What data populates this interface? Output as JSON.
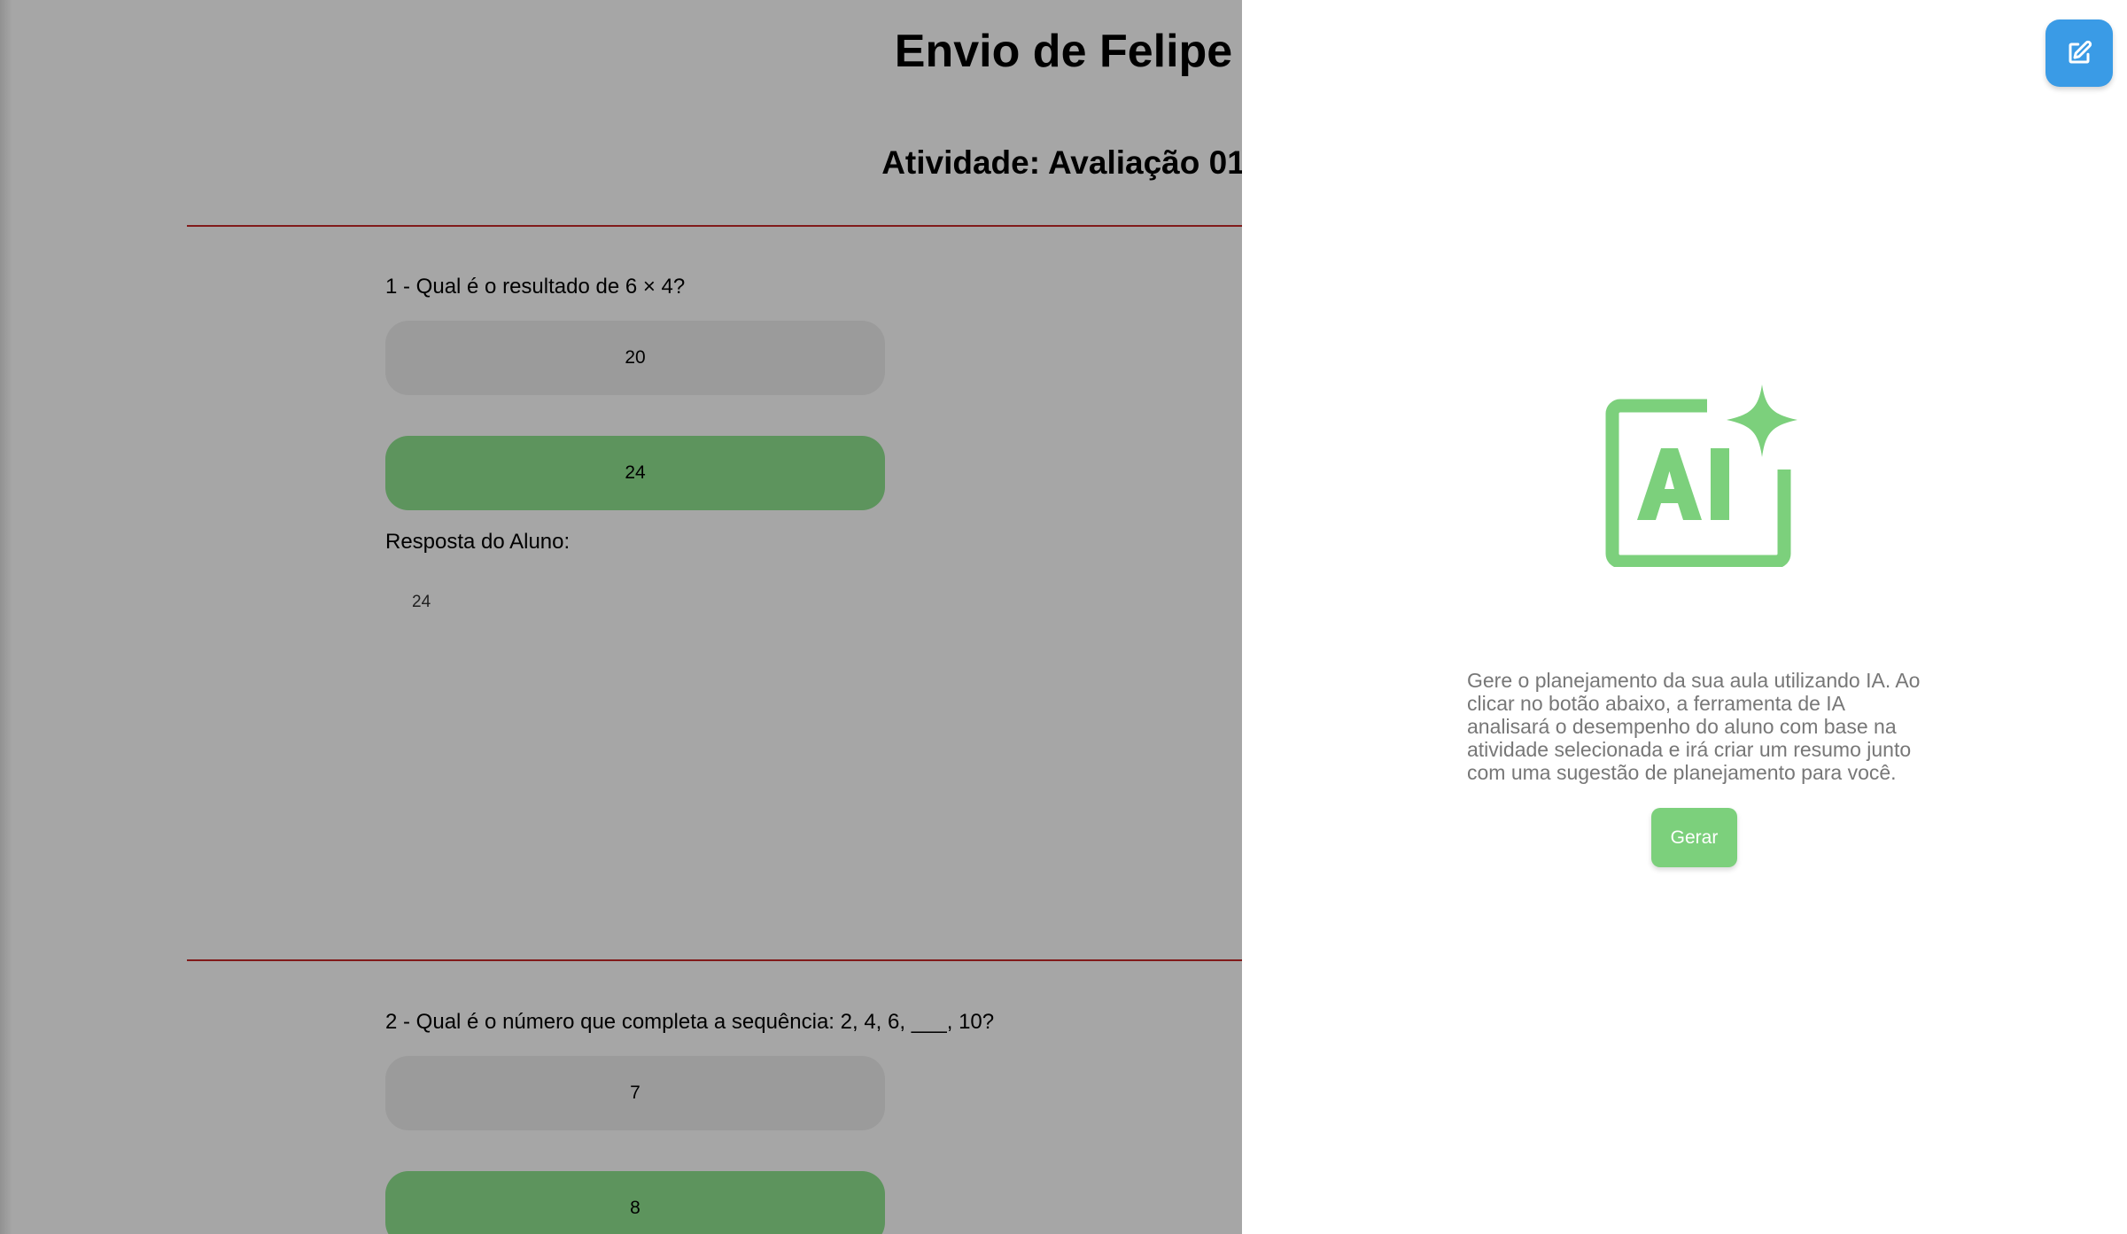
{
  "page": {
    "title": "Envio de Felipe",
    "activity_title": "Atividade: Avaliação 01",
    "answer_label": "Resposta do Aluno:",
    "questions": [
      {
        "text": "1 - Qual é o resultado de 6 × 4?",
        "options": [
          {
            "label": "20",
            "correct": false
          },
          {
            "label": "24",
            "correct": true
          }
        ],
        "student_answer": "24"
      },
      {
        "text": "2 - Qual é o número que completa a sequência: 2, 4, 6, ___, 10?",
        "options": [
          {
            "label": "7",
            "correct": false
          },
          {
            "label": "8",
            "correct": true
          }
        ]
      }
    ]
  },
  "drawer": {
    "description": "Gere o planejamento da sua aula utilizando IA. Ao clicar no botão abaixo, a ferramenta de IA analisará o desempenho do aluno com base na atividade selecionada e irá criar um resumo junto com uma sugestão de planejamento para você.",
    "generate_label": "Gerar",
    "icons": {
      "edit": "edit-icon",
      "ai": "ai-sparkle-icon"
    }
  },
  "colors": {
    "correct_option": "#8fe38f",
    "option": "#efefef",
    "divider": "#c62828",
    "edit_button": "#3a9be6",
    "ai_green": "#7cd07c",
    "overlay": "rgba(0,0,0,0.35)"
  }
}
